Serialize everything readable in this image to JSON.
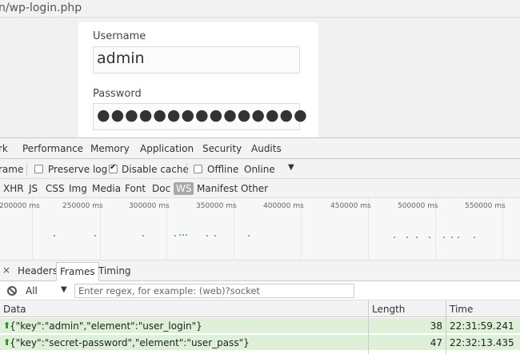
{
  "browser": {
    "url_fragment": "n/wp-login.php"
  },
  "login": {
    "username_label": "Username",
    "username_value": "admin",
    "password_label": "Password",
    "password_mask": "●●●●●●●●●●●●●●●"
  },
  "devtools": {
    "tabs": [
      "rk",
      "Performance",
      "Memory",
      "Application",
      "Security",
      "Audits"
    ],
    "toolbar": {
      "frame": "rame",
      "preserve_log": "Preserve log",
      "disable_cache": "Disable cache",
      "offline": "Offline",
      "throttle": "Online"
    },
    "filters": [
      "XHR",
      "JS",
      "CSS",
      "Img",
      "Media",
      "Font",
      "Doc",
      "WS",
      "Manifest",
      "Other"
    ],
    "timeline_ticks": [
      "200000 ms",
      "250000 ms",
      "300000 ms",
      "350000 ms",
      "400000 ms",
      "450000 ms",
      "500000 ms",
      "550000 ms"
    ],
    "subtabs": {
      "close": "×",
      "headers": "Headers",
      "frames": "Frames",
      "timing": "Timing"
    },
    "frame_filter": {
      "type": "All",
      "placeholder": "Enter regex, for example: (web)?socket"
    },
    "columns": {
      "data": "Data",
      "length": "Length",
      "time": "Time"
    },
    "rows": [
      {
        "data": "{\"key\":\"admin\",\"element\":\"user_login\"}",
        "length": "38",
        "time": "22:31:59.241"
      },
      {
        "data": "{\"key\":\"secret-password\",\"element\":\"user_pass\"}",
        "length": "47",
        "time": "22:32:13.435"
      }
    ]
  }
}
